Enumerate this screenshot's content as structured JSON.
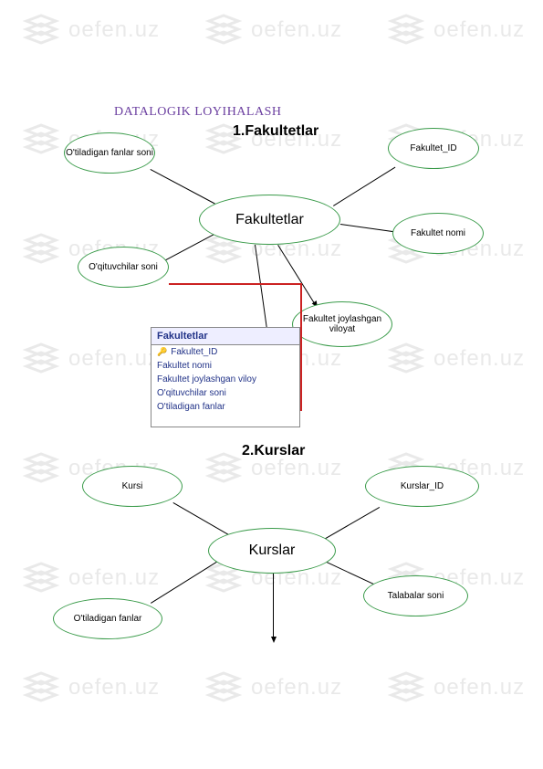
{
  "watermark_text": "oefen.uz",
  "title": "DATALOGIK LOYIHALASH",
  "diagram1": {
    "heading": "1.Fakultetlar",
    "entity": "Fakultetlar",
    "attrs": {
      "a1": "O'tiladigan fanlar soni",
      "a2": "O'qituvchilar soni",
      "a3": "Fakultet_ID",
      "a4": "Fakultet nomi",
      "a5": "Fakultet joylashgan viloyat"
    }
  },
  "dbbox": {
    "table": "Fakultetlar",
    "fields": {
      "f1": "Fakultet_ID",
      "f2": "Fakultet nomi",
      "f3": "Fakultet joylashgan viloy",
      "f4": "O'qituvchilar soni",
      "f5": "O'tiladigan fanlar"
    }
  },
  "diagram2": {
    "heading": "2.Kurslar",
    "entity": "Kurslar",
    "attrs": {
      "a1": "Kursi",
      "a2": "O'tiladigan fanlar",
      "a3": "Kurslar_ID",
      "a4": "Talabalar soni"
    }
  }
}
